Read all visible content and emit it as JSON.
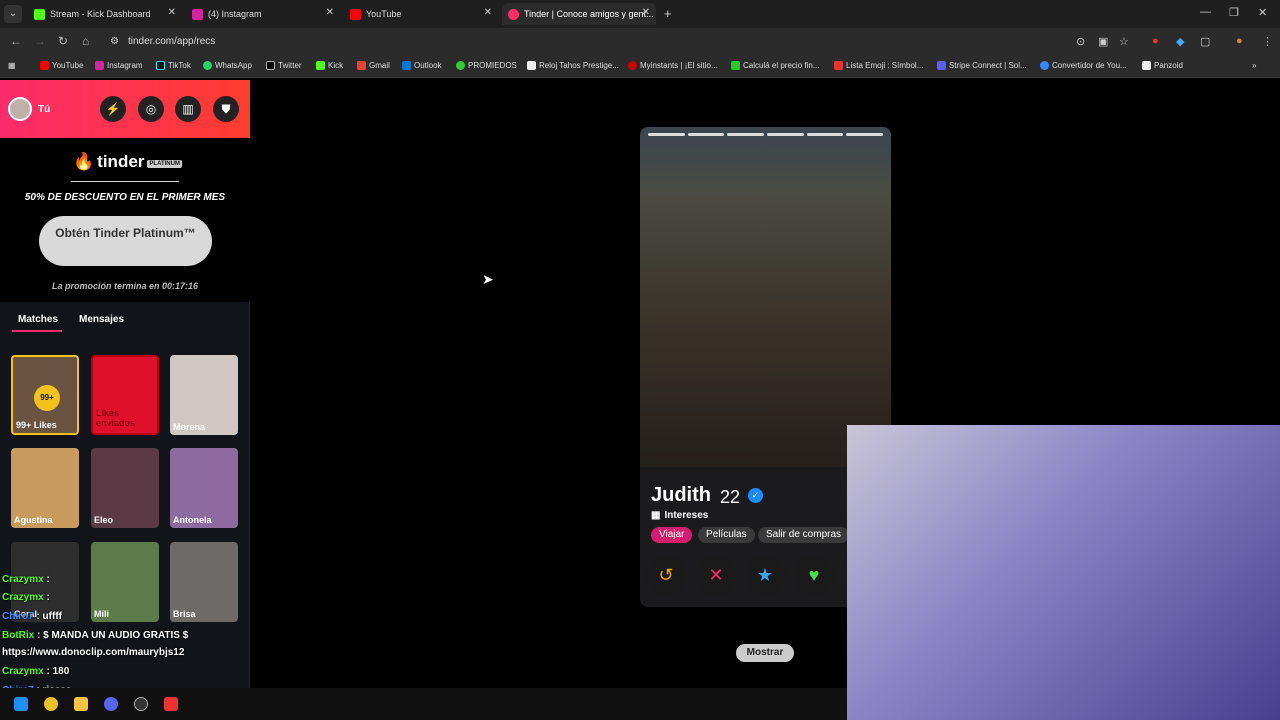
{
  "browser": {
    "tabs": [
      {
        "title": "Stream - Kick Dashboard",
        "color": "#53fc18"
      },
      {
        "title": "(4) Instagram",
        "color": "#d6249f"
      },
      {
        "title": "YouTube",
        "color": "#ff0000"
      },
      {
        "title": "Tinder | Conoce amigos y gent...",
        "color": "#fd2b6b"
      }
    ],
    "url": "tinder.com/app/recs"
  },
  "bookmarks": [
    "YouTube",
    "Instagram",
    "TikTok",
    "WhatsApp",
    "Twitter",
    "Kick",
    "Gmail",
    "Outlook",
    "PROMIEDOS",
    "Reloj Tahos Prestige...",
    "Myinstants | ¡El sitio...",
    "Calculá el precio fin...",
    "Lista Emoji : Símbol...",
    "Stripe Connect | Sol...",
    "Convertidor de You...",
    "Panzoid"
  ],
  "sidebar": {
    "you_label": "Tú",
    "brand": "tinder",
    "platinum_tag": "PLATINUM",
    "offer": "50% DE DESCUENTO EN EL PRIMER MES",
    "cta": "Obtén Tinder Platinum™",
    "timer": "La promoción termina en 00:17:16",
    "tabs": [
      "Matches",
      "Mensajes"
    ],
    "matches": [
      {
        "name": "99+ Likes",
        "badge": "99+"
      },
      {
        "name": "Likes enviados"
      },
      {
        "name": "Morena"
      },
      {
        "name": "Agustina"
      },
      {
        "name": "Eleo"
      },
      {
        "name": "Antonela"
      },
      {
        "name": "Coral"
      },
      {
        "name": "Mili"
      },
      {
        "name": "Brisa"
      }
    ]
  },
  "chat": [
    {
      "user": "Crazymx",
      "msg": ":"
    },
    {
      "user": "Crazymx",
      "msg": ":"
    },
    {
      "user": "Chiro7",
      "msg": ": uffff"
    },
    {
      "user": "BotRix",
      "msg": ": $ MANDA UN AUDIO GRATIS $"
    },
    {
      "user": "",
      "msg": "https://www.donoclip.com/maurybjs12"
    },
    {
      "user": "Crazymx",
      "msg": ": 180"
    },
    {
      "user": "Chiro7",
      "msg": ": ricasa"
    }
  ],
  "profile": {
    "name": "Judith",
    "age": "22",
    "interests_label": "Intereses",
    "interests": [
      "Viajar",
      "Películas",
      "Salir de compras"
    ]
  },
  "show_button": "Mostrar"
}
